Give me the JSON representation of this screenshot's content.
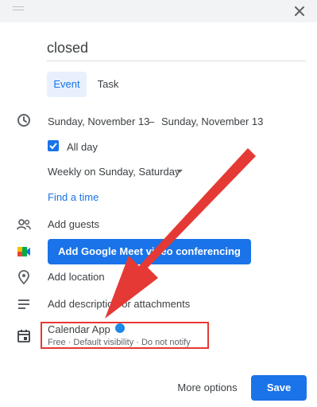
{
  "event": {
    "title": "closed",
    "tabs": {
      "event": "Event",
      "task": "Task"
    },
    "date_start": "Sunday, November 13",
    "date_separator": "–",
    "date_end": "Sunday, November 13",
    "all_day_label": "All day",
    "recurrence": "Weekly on Sunday, Saturday",
    "find_time": "Find a time",
    "add_guests": "Add guests",
    "meet_button": "Add Google Meet video conferencing",
    "add_location": "Add location",
    "add_description": "Add description or attachments",
    "calendar_name": "Calendar App",
    "calendar_details": "Free · Default visibility · Do not notify",
    "more_options": "More options",
    "save": "Save"
  },
  "colors": {
    "accent": "#1a73e8",
    "calendar_dot": "#1e88e5",
    "annotation": "#e53935"
  },
  "icons": [
    "drag-handle-icon",
    "close-icon",
    "clock-icon",
    "checkbox-icon",
    "people-icon",
    "google-meet-icon",
    "location-pin-icon",
    "description-icon",
    "calendar-icon",
    "chevron-down-icon"
  ]
}
